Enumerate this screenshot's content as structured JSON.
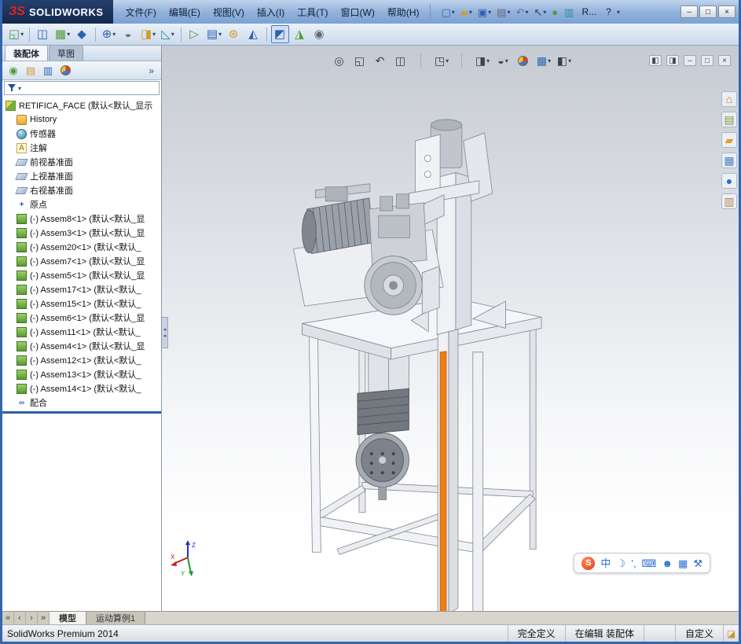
{
  "colors": {
    "accent_orange": "#ec7d17",
    "titlebar_blue": "#8fb0da",
    "logo_red": "#e1251b",
    "tree_split_blue": "#2f5fa5"
  },
  "titlebar": {
    "logo_mark": "ЗS",
    "brand": "SOLIDWORKS",
    "menus": [
      {
        "label": "文件(F)"
      },
      {
        "label": "编辑(E)"
      },
      {
        "label": "视图(V)"
      },
      {
        "label": "插入(I)"
      },
      {
        "label": "工具(T)"
      },
      {
        "label": "窗口(W)"
      },
      {
        "label": "帮助(H)"
      }
    ],
    "quick_tools": [
      {
        "name": "new-document-icon",
        "glyph": "▢",
        "cls": "c-blue",
        "dd": "▾"
      },
      {
        "name": "open-icon",
        "glyph": "▰",
        "cls": "c-amber",
        "dd": "▾"
      },
      {
        "name": "save-icon",
        "glyph": "▣",
        "cls": "c-blue",
        "dd": "▾"
      },
      {
        "name": "print-icon",
        "glyph": "▤",
        "cls": "c-gray",
        "dd": "▾"
      },
      {
        "name": "undo-icon",
        "glyph": "↶",
        "cls": "c-purple",
        "dd": "▾"
      },
      {
        "name": "select-icon",
        "glyph": "↖",
        "cls": "c-dark",
        "dd": "▾"
      },
      {
        "name": "rebuild-icon",
        "glyph": "●",
        "cls": "c-green"
      },
      {
        "name": "file-properties-icon",
        "glyph": "▥",
        "cls": "c-teal"
      }
    ],
    "overflow_label": "R...",
    "help_label": "?",
    "window_buttons": [
      {
        "name": "minimize-window-button",
        "glyph": "–"
      },
      {
        "name": "restore-window-button",
        "glyph": "□"
      },
      {
        "name": "close-window-button",
        "glyph": "×",
        "cls": "close"
      }
    ]
  },
  "toolbar2": {
    "items": [
      {
        "name": "insert-component-icon",
        "glyph": "◱",
        "cls": "c-green",
        "dd": "▾"
      },
      {
        "type": "sep"
      },
      {
        "name": "mate-icon",
        "glyph": "◫",
        "cls": "c-blue"
      },
      {
        "name": "linear-component-pattern-icon",
        "glyph": "▦",
        "cls": "c-green",
        "dd": "▾"
      },
      {
        "name": "smart-fasteners-icon",
        "glyph": "◆",
        "cls": "c-blue"
      },
      {
        "type": "sep"
      },
      {
        "name": "move-component-icon",
        "glyph": "⊕",
        "cls": "c-blue",
        "dd": "▾"
      },
      {
        "name": "show-hidden-components-icon",
        "glyph": "◒",
        "cls": "c-gray"
      },
      {
        "name": "assembly-features-icon",
        "glyph": "◨",
        "cls": "c-amber",
        "dd": "▾"
      },
      {
        "name": "reference-geometry-icon",
        "glyph": "◺",
        "cls": "c-teal",
        "dd": "▾"
      },
      {
        "type": "sep"
      },
      {
        "name": "new-motion-study-icon",
        "glyph": "▷",
        "cls": "c-green"
      },
      {
        "name": "bill-of-materials-icon",
        "glyph": "▤",
        "cls": "c-blue",
        "dd": "▾"
      },
      {
        "name": "exploded-view-icon",
        "glyph": "⊛",
        "cls": "c-amber"
      },
      {
        "name": "explode-line-sketch-icon",
        "glyph": "◭",
        "cls": "c-blue"
      },
      {
        "type": "sep"
      },
      {
        "name": "interference-detection-icon",
        "glyph": "◩",
        "cls": "c-blue sel"
      },
      {
        "name": "assembly-xpert-icon",
        "glyph": "◮",
        "cls": "c-green"
      },
      {
        "name": "take-snapshot-icon",
        "glyph": "◉",
        "cls": "c-gray"
      }
    ]
  },
  "panel": {
    "cm_tabs": [
      {
        "label": "装配体",
        "cls": "active"
      },
      {
        "label": "草图"
      }
    ],
    "fm_icons": [
      {
        "name": "featuremanager-tab-icon",
        "glyph": "◉",
        "cls": "c-green"
      },
      {
        "name": "propertymanager-tab-icon",
        "glyph": "▤",
        "cls": "c-amber"
      },
      {
        "name": "configurationmanager-tab-icon",
        "glyph": "▥",
        "cls": "c-blue"
      },
      {
        "name": "displaymanager-tab-icon",
        "cls": "ball"
      }
    ],
    "fm_overflow": "»",
    "filter_dd": "▾",
    "tree": {
      "root": {
        "label": "RETIFICA_FACE (默认<默认_显示",
        "icon": "assembly-root"
      },
      "items": [
        {
          "icon": "history",
          "label": "History"
        },
        {
          "icon": "sensors",
          "label": "传感器"
        },
        {
          "icon": "annotations",
          "label": "注解"
        },
        {
          "icon": "plane",
          "label": "前视基准面"
        },
        {
          "icon": "plane",
          "label": "上视基准面"
        },
        {
          "icon": "plane",
          "label": "右视基准面"
        },
        {
          "icon": "origin",
          "label": "原点"
        },
        {
          "icon": "assembly",
          "label": "(-) Assem8<1> (默认<默认_显"
        },
        {
          "icon": "assembly",
          "label": "(-) Assem3<1> (默认<默认_显"
        },
        {
          "icon": "assembly",
          "label": "(-) Assem20<1> (默认<默认_"
        },
        {
          "icon": "assembly",
          "label": "(-) Assem7<1> (默认<默认_显"
        },
        {
          "icon": "assembly",
          "label": "(-) Assem5<1> (默认<默认_显"
        },
        {
          "icon": "assembly",
          "label": "(-) Assem17<1> (默认<默认_"
        },
        {
          "icon": "assembly",
          "label": "(-) Assem15<1> (默认<默认_"
        },
        {
          "icon": "assembly",
          "label": "(-) Assem6<1> (默认<默认_显"
        },
        {
          "icon": "assembly",
          "label": "(-) Assem11<1> (默认<默认_"
        },
        {
          "icon": "assembly",
          "label": "(-) Assem4<1> (默认<默认_显"
        },
        {
          "icon": "assembly",
          "label": "(-) Assem12<1> (默认<默认_"
        },
        {
          "icon": "assembly",
          "label": "(-) Assem13<1> (默认<默认_"
        },
        {
          "icon": "assembly",
          "label": "(-) Assem14<1> (默认<默认_"
        },
        {
          "icon": "mates",
          "label": "配合"
        }
      ]
    },
    "collapse_glyph": "◂"
  },
  "hud": {
    "items": [
      {
        "name": "zoom-to-fit-icon",
        "glyph": "◎",
        "cls": "c-dark"
      },
      {
        "name": "zoom-to-area-icon",
        "glyph": "◱",
        "cls": "c-dark"
      },
      {
        "name": "previous-view-icon",
        "glyph": "↶",
        "cls": "c-dark"
      },
      {
        "name": "section-view-icon",
        "glyph": "◫",
        "cls": "c-dark"
      },
      {
        "type": "sep"
      },
      {
        "name": "view-orientation-icon",
        "glyph": "◳",
        "cls": "c-dark",
        "dd": "▾"
      },
      {
        "type": "sep"
      },
      {
        "name": "display-style-icon",
        "glyph": "◨",
        "cls": "c-dark",
        "dd": "▾"
      },
      {
        "name": "hide-show-items-icon",
        "glyph": "◒",
        "cls": "c-dark",
        "dd": "▾"
      },
      {
        "name": "edit-appearance-icon",
        "cls": "ball"
      },
      {
        "name": "apply-scene-icon",
        "glyph": "▦",
        "cls": "c-blue",
        "dd": "▾"
      },
      {
        "name": "view-settings-icon",
        "glyph": "◧",
        "cls": "c-dark",
        "dd": "▾"
      }
    ]
  },
  "doc_controls": [
    {
      "name": "toggle-left-pane-icon",
      "glyph": "◧"
    },
    {
      "name": "toggle-right-pane-icon",
      "glyph": "◨"
    },
    {
      "name": "minimize-document-icon",
      "glyph": "–"
    },
    {
      "name": "restore-document-icon",
      "glyph": "□"
    },
    {
      "name": "close-document-icon",
      "glyph": "×"
    }
  ],
  "task_pane": [
    {
      "name": "solidworks-resources-icon",
      "glyph": "⌂",
      "color": "#c8772a"
    },
    {
      "name": "design-library-icon",
      "glyph": "▤",
      "color": "#6f9a3d"
    },
    {
      "name": "file-explorer-icon",
      "glyph": "▰",
      "color": "#d8a433"
    },
    {
      "name": "view-palette-icon",
      "glyph": "▦",
      "color": "#4a7fc1"
    },
    {
      "name": "appearances-scenes-icon",
      "glyph": "●",
      "color": "#2f6fd0"
    },
    {
      "name": "custom-properties-icon",
      "glyph": "▥",
      "color": "#a8874b"
    }
  ],
  "langbar": {
    "logo": "S",
    "items": [
      {
        "name": "input-mode-chinese-icon",
        "glyph": "中"
      },
      {
        "name": "skin-moon-icon",
        "glyph": "☽"
      },
      {
        "name": "punctuation-icon",
        "glyph": "’,"
      },
      {
        "name": "soft-keyboard-icon",
        "glyph": "⌨"
      },
      {
        "name": "account-icon",
        "glyph": "☻"
      },
      {
        "name": "toolbox-icon",
        "glyph": "▦"
      },
      {
        "name": "tools-wrench-icon",
        "glyph": "⚒"
      }
    ]
  },
  "bottom_tabs": {
    "nav": [
      {
        "name": "first-tab-button",
        "glyph": "«"
      },
      {
        "name": "prev-tab-button",
        "glyph": "‹"
      },
      {
        "name": "next-tab-button",
        "glyph": "›"
      },
      {
        "name": "last-tab-button",
        "glyph": "»"
      }
    ],
    "tabs": [
      {
        "label": "模型",
        "cls": "active"
      },
      {
        "label": "运动算例1"
      }
    ]
  },
  "statusbar": {
    "left": "SolidWorks Premium 2014",
    "defined": "完全定义",
    "editing": "在编辑 装配体",
    "custom": "自定义",
    "icon_glyph": "◪"
  },
  "triad": {
    "x": "X",
    "y": "Y",
    "z": "Z"
  }
}
